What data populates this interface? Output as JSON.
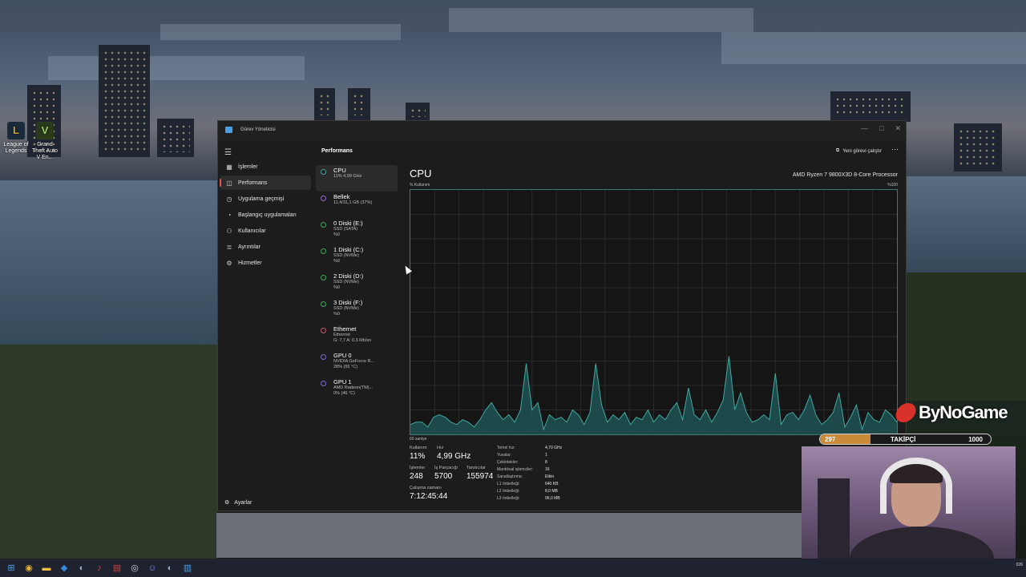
{
  "desktop": {
    "icons": [
      {
        "label": "League of Legends",
        "icon": "league-of-legends-icon",
        "color": "#c8a24a"
      },
      {
        "label": "Grand Theft Auto V En...",
        "icon": "gta-v-icon",
        "color": "#5a8a3a"
      }
    ]
  },
  "window": {
    "title": "Görev Yöneticisi",
    "buttons": [
      "minimize-icon",
      "maximize-icon",
      "close-icon"
    ]
  },
  "nav": {
    "items": [
      {
        "label": "İşlemler",
        "icon": "processes-icon",
        "active": false
      },
      {
        "label": "Performans",
        "icon": "performance-icon",
        "active": true
      },
      {
        "label": "Uygulama geçmişi",
        "icon": "app-history-icon",
        "active": false
      },
      {
        "label": "Başlangıç uygulamaları",
        "icon": "startup-icon",
        "active": false
      },
      {
        "label": "Kullanıcılar",
        "icon": "users-icon",
        "active": false
      },
      {
        "label": "Ayrıntılar",
        "icon": "details-icon",
        "active": false
      },
      {
        "label": "Hizmetler",
        "icon": "services-icon",
        "active": false
      }
    ],
    "settings_label": "Ayarlar"
  },
  "cmdbar": {
    "page_title": "Performans",
    "new_task_label": "Yeni görevi çalıştır",
    "more_label": "···"
  },
  "devices": [
    {
      "name": "CPU",
      "lines": [
        "11% 4,99 GHz"
      ],
      "active": true,
      "color": "#3fa9a0"
    },
    {
      "name": "Bellek",
      "lines": [
        "11,4/31,1 GB (37%)"
      ],
      "active": false,
      "color": "#9a6bd6"
    },
    {
      "name": "0 Diski (E:)",
      "lines": [
        "SSD (SATA)",
        "%0"
      ],
      "active": false,
      "color": "#3faa5a"
    },
    {
      "name": "1 Diski (C:)",
      "lines": [
        "SSD (NVMe)",
        "%0"
      ],
      "active": false,
      "color": "#3faa5a"
    },
    {
      "name": "2 Diski (D:)",
      "lines": [
        "SSD (NVMe)",
        "%0"
      ],
      "active": false,
      "color": "#3faa5a"
    },
    {
      "name": "3 Diski (F:)",
      "lines": [
        "SSD (NVMe)",
        "%0"
      ],
      "active": false,
      "color": "#3faa5a"
    },
    {
      "name": "Ethernet",
      "lines": [
        "Ethernet",
        "G: 7,7 A: 0,3 Mb/sn"
      ],
      "active": false,
      "color": "#c05f6c"
    },
    {
      "name": "GPU 0",
      "lines": [
        "NVIDIA GeForce R...",
        "28% (55 °C)"
      ],
      "active": false,
      "color": "#7d6bd6"
    },
    {
      "name": "GPU 1",
      "lines": [
        "AMD Radeon(TM)...",
        "0% (46 °C)"
      ],
      "active": false,
      "color": "#7d6bd6"
    }
  ],
  "detail": {
    "heading": "CPU",
    "cpu_name": "AMD Ryzen 7 9800X3D 8-Core Processor",
    "usage_label": "% Kullanım",
    "max_label": "%100",
    "time_label": "60 saniye",
    "usage_history": [
      0.04,
      0.05,
      0.05,
      0.03,
      0.07,
      0.08,
      0.07,
      0.05,
      0.04,
      0.06,
      0.05,
      0.03,
      0.06,
      0.1,
      0.13,
      0.09,
      0.06,
      0.08,
      0.05,
      0.1,
      0.29,
      0.1,
      0.13,
      0.02,
      0.08,
      0.06,
      0.07,
      0.05,
      0.1,
      0.08,
      0.04,
      0.09,
      0.29,
      0.12,
      0.05,
      0.08,
      0.06,
      0.09,
      0.04,
      0.07,
      0.06,
      0.1,
      0.05,
      0.08,
      0.06,
      0.1,
      0.13,
      0.06,
      0.19,
      0.08,
      0.06,
      0.1,
      0.05,
      0.09,
      0.14,
      0.32,
      0.1,
      0.17,
      0.09,
      0.05,
      0.06,
      0.08,
      0.06,
      0.25,
      0.04,
      0.08,
      0.09,
      0.06,
      0.1,
      0.16,
      0.08,
      0.04,
      0.06,
      0.09,
      0.17,
      0.03,
      0.07,
      0.12,
      0.02,
      0.09,
      0.06,
      0.05,
      0.1,
      0.08,
      0.05
    ]
  },
  "stats": {
    "utilization": {
      "label": "Kullanım",
      "value": "11%"
    },
    "speed": {
      "label": "Hız",
      "value": "4,99 GHz"
    },
    "processes": {
      "label": "İşlemler",
      "value": "248"
    },
    "threads": {
      "label": "İş Parçacığı",
      "value": "5700"
    },
    "handles": {
      "label": "Tanıtıcılar",
      "value": "155974"
    },
    "uptime": {
      "label": "Çalışma zamanı",
      "value": "7:12:45:44"
    }
  },
  "specs": [
    {
      "label": "Temel hız:",
      "value": "4,70 GHz"
    },
    {
      "label": "Yuvalar:",
      "value": "1"
    },
    {
      "label": "Çekirdekler:",
      "value": "8"
    },
    {
      "label": "Mantıksal işlemciler:",
      "value": "16"
    },
    {
      "label": "Sanallaştırma:",
      "value": "Etkin"
    },
    {
      "label": "L1 önbelleği:",
      "value": "640 KB"
    },
    {
      "label": "L2 önbelleği:",
      "value": "8,0 MB"
    },
    {
      "label": "L3 önbelleği:",
      "value": "96,0 MB"
    }
  ],
  "overlay": {
    "brand": "ByNoGame",
    "follower_current": "297",
    "follower_label": "TAKİPÇİ",
    "follower_goal": "1000",
    "follower_progress": 0.297
  },
  "taskbar": {
    "apps": [
      "windows-start-icon",
      "chrome-icon",
      "file-explorer-icon",
      "store-icon",
      "steam-icon",
      "music-icon",
      "calendar-icon",
      "obs-icon",
      "discord-icon",
      "steam-icon",
      "task-manager-icon"
    ],
    "tray_text": "026"
  },
  "colors": {
    "accent": "#3fa9a0",
    "nav_indicator": "#e05555",
    "window_bg": "#1c1c1c"
  }
}
